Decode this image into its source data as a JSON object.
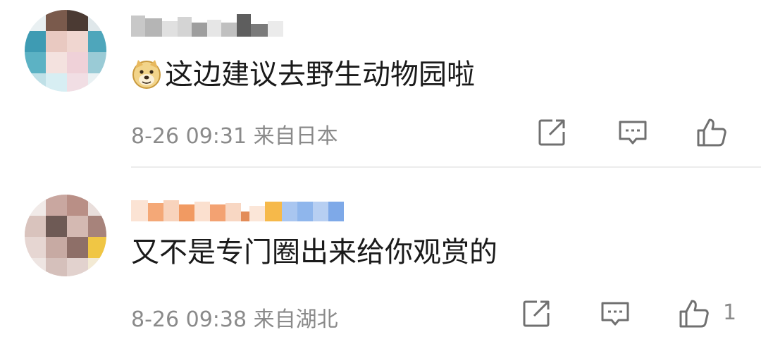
{
  "comments": [
    {
      "text": "这边建议去野生动物园啦",
      "time": "8-26 09:31",
      "location": "来自日本",
      "avatar_icon": "blurred-avatar",
      "emoji_icon": "doge-emoji-icon"
    },
    {
      "text": "又不是专门圈出来给你观赏的",
      "time": "8-26 09:38",
      "location": "来自湖北",
      "like_count": "1",
      "avatar_icon": "blurred-avatar"
    }
  ],
  "icons": {
    "share": "share-icon",
    "comment": "comment-icon",
    "like": "like-icon"
  },
  "colors": {
    "text": "#1a1a1a",
    "meta": "#8a8a8a",
    "icon": "#707070",
    "divider": "#ececec"
  }
}
